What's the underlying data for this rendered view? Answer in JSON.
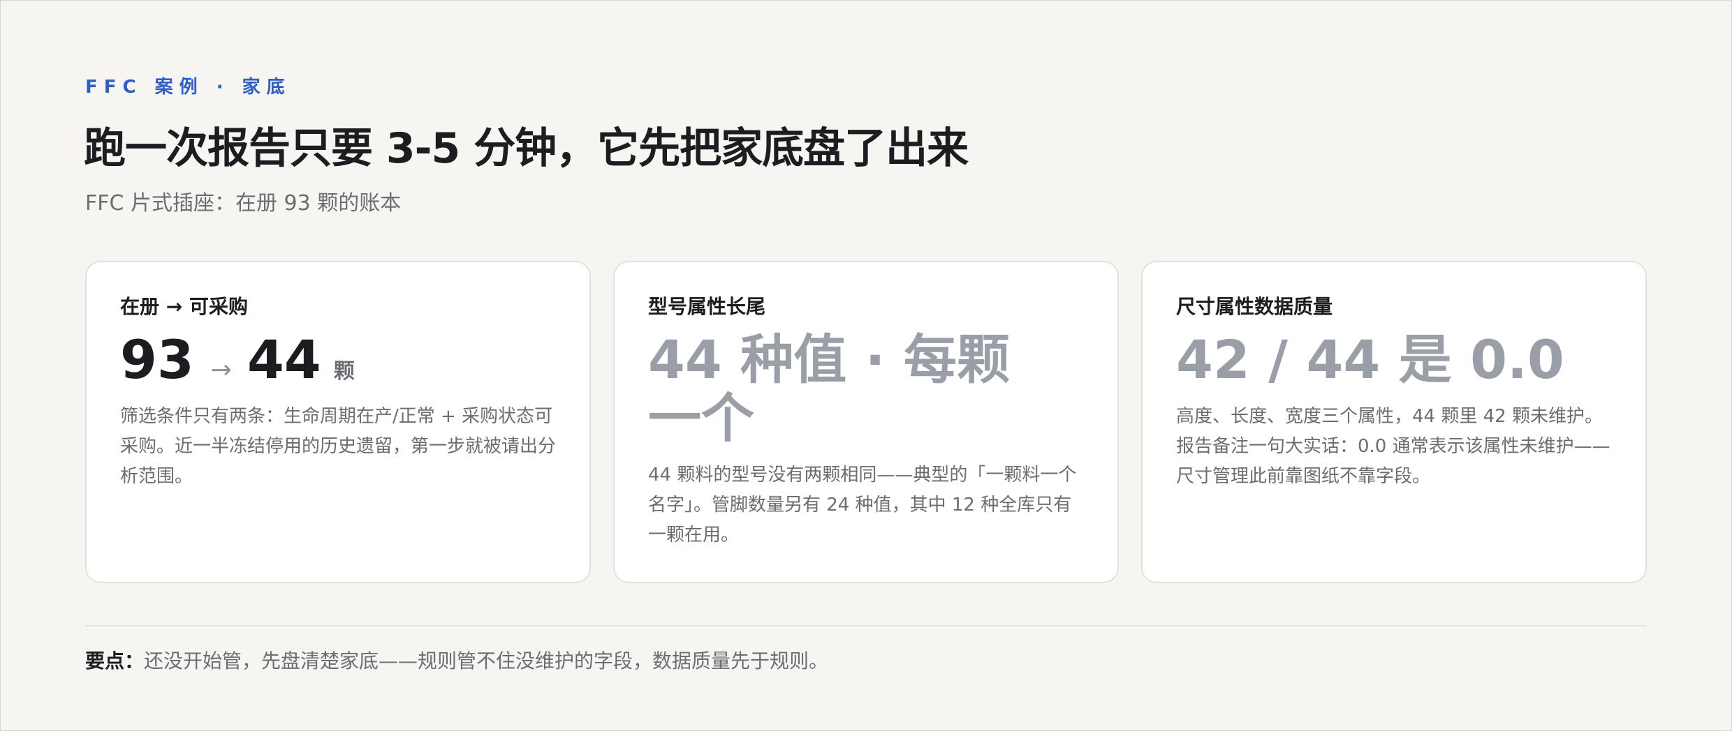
{
  "eyebrow": "FFC 案例 · 家底",
  "headline": "跑一次报告只要 3-5 分钟，它先把家底盘了出来",
  "subtitle": "FFC 片式插座：在册 93 颗的账本",
  "cards": [
    {
      "title": "在册 → 可采购",
      "value_from": "93",
      "arrow": "→",
      "value_to": "44",
      "unit": "颗",
      "desc": "筛选条件只有两条：生命周期在产/正常 + 采购状态可采购。近一半冻结停用的历史遗留，第一步就被请出分析范围。"
    },
    {
      "title": "型号属性长尾",
      "value": "44 种值 · 每颗一个",
      "desc": "44 颗料的型号没有两颗相同——典型的「一颗料一个名字」。管脚数量另有 24 种值，其中 12 种全库只有一颗在用。"
    },
    {
      "title": "尺寸属性数据质量",
      "value": "42 / 44 是 0.0",
      "desc": "高度、长度、宽度三个属性，44 颗里 42 颗未维护。报告备注一句大实话：0.0 通常表示该属性未维护——尺寸管理此前靠图纸不靠字段。"
    }
  ],
  "keypoint": {
    "label": "要点：",
    "text": "还没开始管，先盘清楚家底——规则管不住没维护的字段，数据质量先于规则。"
  },
  "colors": {
    "background": "#f6f5f2",
    "accent": "#2f5fc4",
    "muted_value": "#9a9ea6",
    "text": "#1c1d20"
  }
}
